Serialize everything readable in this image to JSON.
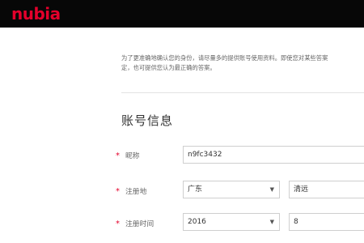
{
  "header": {
    "logo_text": "nubia",
    "logo_color": "#e4002b",
    "background": "#070707"
  },
  "intro": {
    "text": "为了更准确地确认您的身份，请尽量多的提供账号使用资料。即使您对某些答案\n定，也可提供您认为最正确的答案。"
  },
  "section": {
    "title": "账号信息"
  },
  "form": {
    "required_mark": "*",
    "nickname": {
      "label": "昵称",
      "value": "n9fc3432"
    },
    "register_region": {
      "label": "注册地",
      "province": "广东",
      "city": "清远"
    },
    "register_time": {
      "label": "注册时间",
      "year": "2016",
      "month": "8"
    }
  }
}
